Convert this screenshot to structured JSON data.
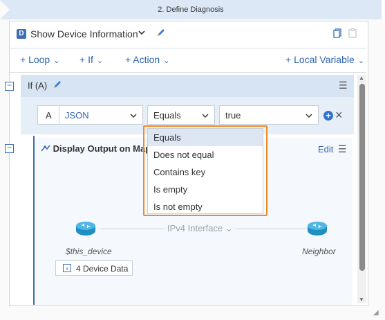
{
  "step_banner": {
    "label": "2. Define Diagnosis"
  },
  "header": {
    "badge": "D",
    "title": "Show Device Information"
  },
  "toolbar": {
    "loop": "+ Loop",
    "if": "+ If",
    "action": "+ Action",
    "local_variable": "+ Local Variable"
  },
  "if_block": {
    "label": "If (A)"
  },
  "condition": {
    "alias": "A",
    "source": "JSON",
    "operator": "Equals",
    "value": "true"
  },
  "display_output": {
    "title": "Display Output on Map",
    "edit_label": "Edit",
    "interface_label": "IPv4 Interface",
    "left_node": "$this_device",
    "right_node": "Neighbor",
    "device_data": "4 Device Data"
  },
  "operator_dropdown": {
    "options": [
      "Equals",
      "Does not equal",
      "Contains key",
      "Is empty",
      "Is not empty"
    ],
    "selected": "Equals"
  },
  "colors": {
    "accent": "#2f63b3",
    "highlight": "#f08a24",
    "if_bg": "#d6e4f3"
  }
}
